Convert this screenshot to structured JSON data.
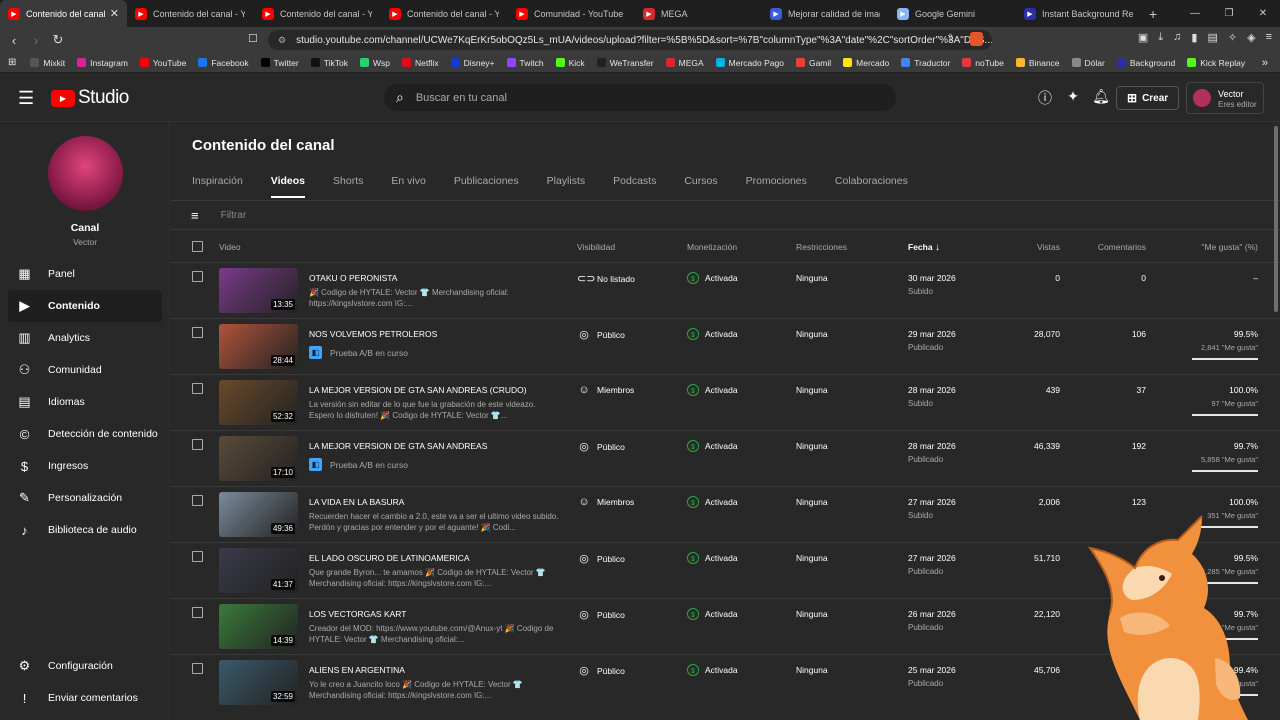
{
  "browser": {
    "tabs": [
      {
        "label": "Contenido del canal - YouTube",
        "active": true,
        "color": "#ff0000"
      },
      {
        "label": "Contenido del canal - YouTube",
        "active": false,
        "color": "#ff0000"
      },
      {
        "label": "Contenido del canal - YouTube",
        "active": false,
        "color": "#ff0000"
      },
      {
        "label": "Contenido del canal - YouTube",
        "active": false,
        "color": "#ff0000"
      },
      {
        "label": "Comunidad - YouTube Studio",
        "active": false,
        "color": "#ff0000"
      },
      {
        "label": "MEGA",
        "active": false,
        "color": "#d9272e"
      },
      {
        "label": "Mejorar calidad de imagen",
        "active": false,
        "color": "#3b5bdb"
      },
      {
        "label": "Google Gemini",
        "active": false,
        "color": "#8ab4f8"
      },
      {
        "label": "Instant Background Remover",
        "active": false,
        "color": "#2b2fa8"
      }
    ],
    "url": "studio.youtube.com/channel/UCWe7KqErKr5obOQz5Ls_mUA/videos/upload?filter=%5B%5D&sort=%7B\"columnType\"%3A\"date\"%2C\"sortOrder\"%3A\"DES...",
    "bookmarks": [
      {
        "label": "Mixkit",
        "color": "#555"
      },
      {
        "label": "Instagram",
        "color": "#d6249f"
      },
      {
        "label": "YouTube",
        "color": "#ff0000"
      },
      {
        "label": "Facebook",
        "color": "#1877f2"
      },
      {
        "label": "Twitter",
        "color": "#000000"
      },
      {
        "label": "TikTok",
        "color": "#111111"
      },
      {
        "label": "Wsp",
        "color": "#25d366"
      },
      {
        "label": "Netflix",
        "color": "#e50914"
      },
      {
        "label": "Disney+",
        "color": "#113ccf"
      },
      {
        "label": "Twitch",
        "color": "#9146ff"
      },
      {
        "label": "Kick",
        "color": "#53fc18"
      },
      {
        "label": "WeTransfer",
        "color": "#222222"
      },
      {
        "label": "MEGA",
        "color": "#d9272e"
      },
      {
        "label": "Mercado Pago",
        "color": "#00b1ea"
      },
      {
        "label": "Gamil",
        "color": "#ea4335"
      },
      {
        "label": "Mercado",
        "color": "#ffe600"
      },
      {
        "label": "Traductor",
        "color": "#4285f4"
      },
      {
        "label": "noTube",
        "color": "#e53935"
      },
      {
        "label": "Binance",
        "color": "#f3ba2f"
      },
      {
        "label": "Dólar",
        "color": "#888888"
      },
      {
        "label": "Background",
        "color": "#2b2fa8"
      },
      {
        "label": "Kick Replay",
        "color": "#53fc18"
      }
    ]
  },
  "header": {
    "logo_text": "Studio",
    "search_placeholder": "Buscar en tu canal",
    "create_label": "Crear",
    "account_name": "Vector",
    "account_role": "Eres editor"
  },
  "sidebar": {
    "channel_label": "Canal",
    "channel_name": "Vector",
    "items": [
      {
        "label": "Panel",
        "icon": "dashboard-icon",
        "selected": false
      },
      {
        "label": "Contenido",
        "icon": "content-icon",
        "selected": true
      },
      {
        "label": "Analytics",
        "icon": "analytics-icon",
        "selected": false
      },
      {
        "label": "Comunidad",
        "icon": "community-icon",
        "selected": false
      },
      {
        "label": "Idiomas",
        "icon": "subtitles-icon",
        "selected": false
      },
      {
        "label": "Detección de contenido",
        "icon": "copyright-icon",
        "selected": false
      },
      {
        "label": "Ingresos",
        "icon": "earn-icon",
        "selected": false
      },
      {
        "label": "Personalización",
        "icon": "customization-icon",
        "selected": false
      },
      {
        "label": "Biblioteca de audio",
        "icon": "audio-library-icon",
        "selected": false
      }
    ],
    "bottom": [
      {
        "label": "Configuración",
        "icon": "gear-icon"
      },
      {
        "label": "Enviar comentarios",
        "icon": "feedback-icon"
      }
    ]
  },
  "main": {
    "title": "Contenido del canal",
    "tabs": [
      "Inspiración",
      "Videos",
      "Shorts",
      "En vivo",
      "Publicaciones",
      "Playlists",
      "Podcasts",
      "Cursos",
      "Promociones",
      "Colaboraciones"
    ],
    "selected_tab": 1,
    "filter_placeholder": "Filtrar",
    "columns": {
      "video": "Video",
      "visibility": "Visibilidad",
      "monetization": "Monetización",
      "restrictions": "Restricciones",
      "date": "Fecha",
      "views": "Vistas",
      "comments": "Comentarios",
      "likes": "\"Me gusta\" (%)"
    },
    "rows": [
      {
        "title": "OTAKU O PERONISTA",
        "desc": "🎉 Codigo de HYTALE: Vector 👕 Merchandising oficial: https://kingslvstore.com IG:...",
        "ab": "",
        "duration": "13:35",
        "thumb": "#7a3a8a",
        "visibility": "No listado",
        "vis_icon": "unlisted-icon",
        "monetization": "Activada",
        "restrictions": "Ninguna",
        "date": "30 mar 2026",
        "status": "Subido",
        "views": "0",
        "comments": "0",
        "likes": "–",
        "likes_count": "",
        "like_ratio": null
      },
      {
        "title": "NOS VOLVEMOS PETROLEROS",
        "desc": "",
        "ab": "Prueba A/B en curso",
        "duration": "28:44",
        "thumb": "#b0543a",
        "visibility": "Público",
        "vis_icon": "globe-icon",
        "monetization": "Activada",
        "restrictions": "Ninguna",
        "date": "29 mar 2026",
        "status": "Publicado",
        "views": "28,070",
        "comments": "106",
        "likes": "99.5%",
        "likes_count": "2,841 \"Me gusta\"",
        "like_ratio": 0.995
      },
      {
        "title": "LA MEJOR VERSION DE GTA SAN ANDREAS (CRUDO)",
        "desc": "La versión sin editar de lo que fue la grabación de este videazo. Espero lo disfruten! 🎉 Codigo de HYTALE: Vector 👕...",
        "ab": "",
        "duration": "52:32",
        "thumb": "#6a4a2a",
        "visibility": "Miembros",
        "vis_icon": "members-icon",
        "monetization": "Activada",
        "restrictions": "Ninguna",
        "date": "28 mar 2026",
        "status": "Subido",
        "views": "439",
        "comments": "37",
        "likes": "100.0%",
        "likes_count": "97 \"Me gusta\"",
        "like_ratio": 1.0
      },
      {
        "title": "LA MEJOR VERSION DE GTA SAN ANDREAS",
        "desc": "",
        "ab": "Prueba A/B en curso",
        "duration": "17:10",
        "thumb": "#5a4a3a",
        "visibility": "Público",
        "vis_icon": "globe-icon",
        "monetization": "Activada",
        "restrictions": "Ninguna",
        "date": "28 mar 2026",
        "status": "Publicado",
        "views": "46,339",
        "comments": "192",
        "likes": "99.7%",
        "likes_count": "5,858 \"Me gusta\"",
        "like_ratio": 0.997
      },
      {
        "title": "LA VIDA EN LA BASURA",
        "desc": "Recuerden hacer el cambio a 2.0, este va a ser el ultimo video subido. Perdón y gracias por entender y por el aguante! 🎉 Codi...",
        "ab": "",
        "duration": "49:36",
        "thumb": "#7a8a9a",
        "visibility": "Miembros",
        "vis_icon": "members-icon",
        "monetization": "Activada",
        "restrictions": "Ninguna",
        "date": "27 mar 2026",
        "status": "Subido",
        "views": "2,006",
        "comments": "123",
        "likes": "100.0%",
        "likes_count": "351 \"Me gusta\"",
        "like_ratio": 1.0
      },
      {
        "title": "EL LADO OSCURO DE LATINOAMERICA",
        "desc": "Que grande Byron... te amamos 🎉 Codigo de HYTALE: Vector 👕 Merchandising oficial: https://kingslvstore.com IG:...",
        "ab": "",
        "duration": "41:37",
        "thumb": "#3a3a4a",
        "visibility": "Público",
        "vis_icon": "globe-icon",
        "monetization": "Activada",
        "restrictions": "Ninguna",
        "date": "27 mar 2026",
        "status": "Publicado",
        "views": "51,710",
        "comments": "",
        "likes": "99.5%",
        "likes_count": "4,285 \"Me gusta\"",
        "like_ratio": 0.995
      },
      {
        "title": "LOS VECTORGAS KART",
        "desc": "Creador del MOD: https://www.youtube.com/@Anux-yt 🎉 Codigo de HYTALE: Vector 👕 Merchandising oficial:...",
        "ab": "",
        "duration": "14:39",
        "thumb": "#3a7a3a",
        "visibility": "Público",
        "vis_icon": "globe-icon",
        "monetization": "Activada",
        "restrictions": "Ninguna",
        "date": "26 mar 2026",
        "status": "Publicado",
        "views": "22,120",
        "comments": "",
        "likes": "99.7%",
        "likes_count": "2,928 \"Me gusta\"",
        "like_ratio": 0.997
      },
      {
        "title": "ALIENS EN ARGENTINA",
        "desc": "Yo le creo a Juancito loco 🎉 Codigo de HYTALE: Vector 👕 Merchandising oficial: https://kingslvstore.com IG:...",
        "ab": "",
        "duration": "32:59",
        "thumb": "#3a5a6a",
        "visibility": "Público",
        "vis_icon": "globe-icon",
        "monetization": "Activada",
        "restrictions": "Ninguna",
        "date": "25 mar 2026",
        "status": "Publicado",
        "views": "45,706",
        "comments": "",
        "likes": "99.4%",
        "likes_count": "\"Me gusta\"",
        "like_ratio": 0.994
      }
    ]
  }
}
